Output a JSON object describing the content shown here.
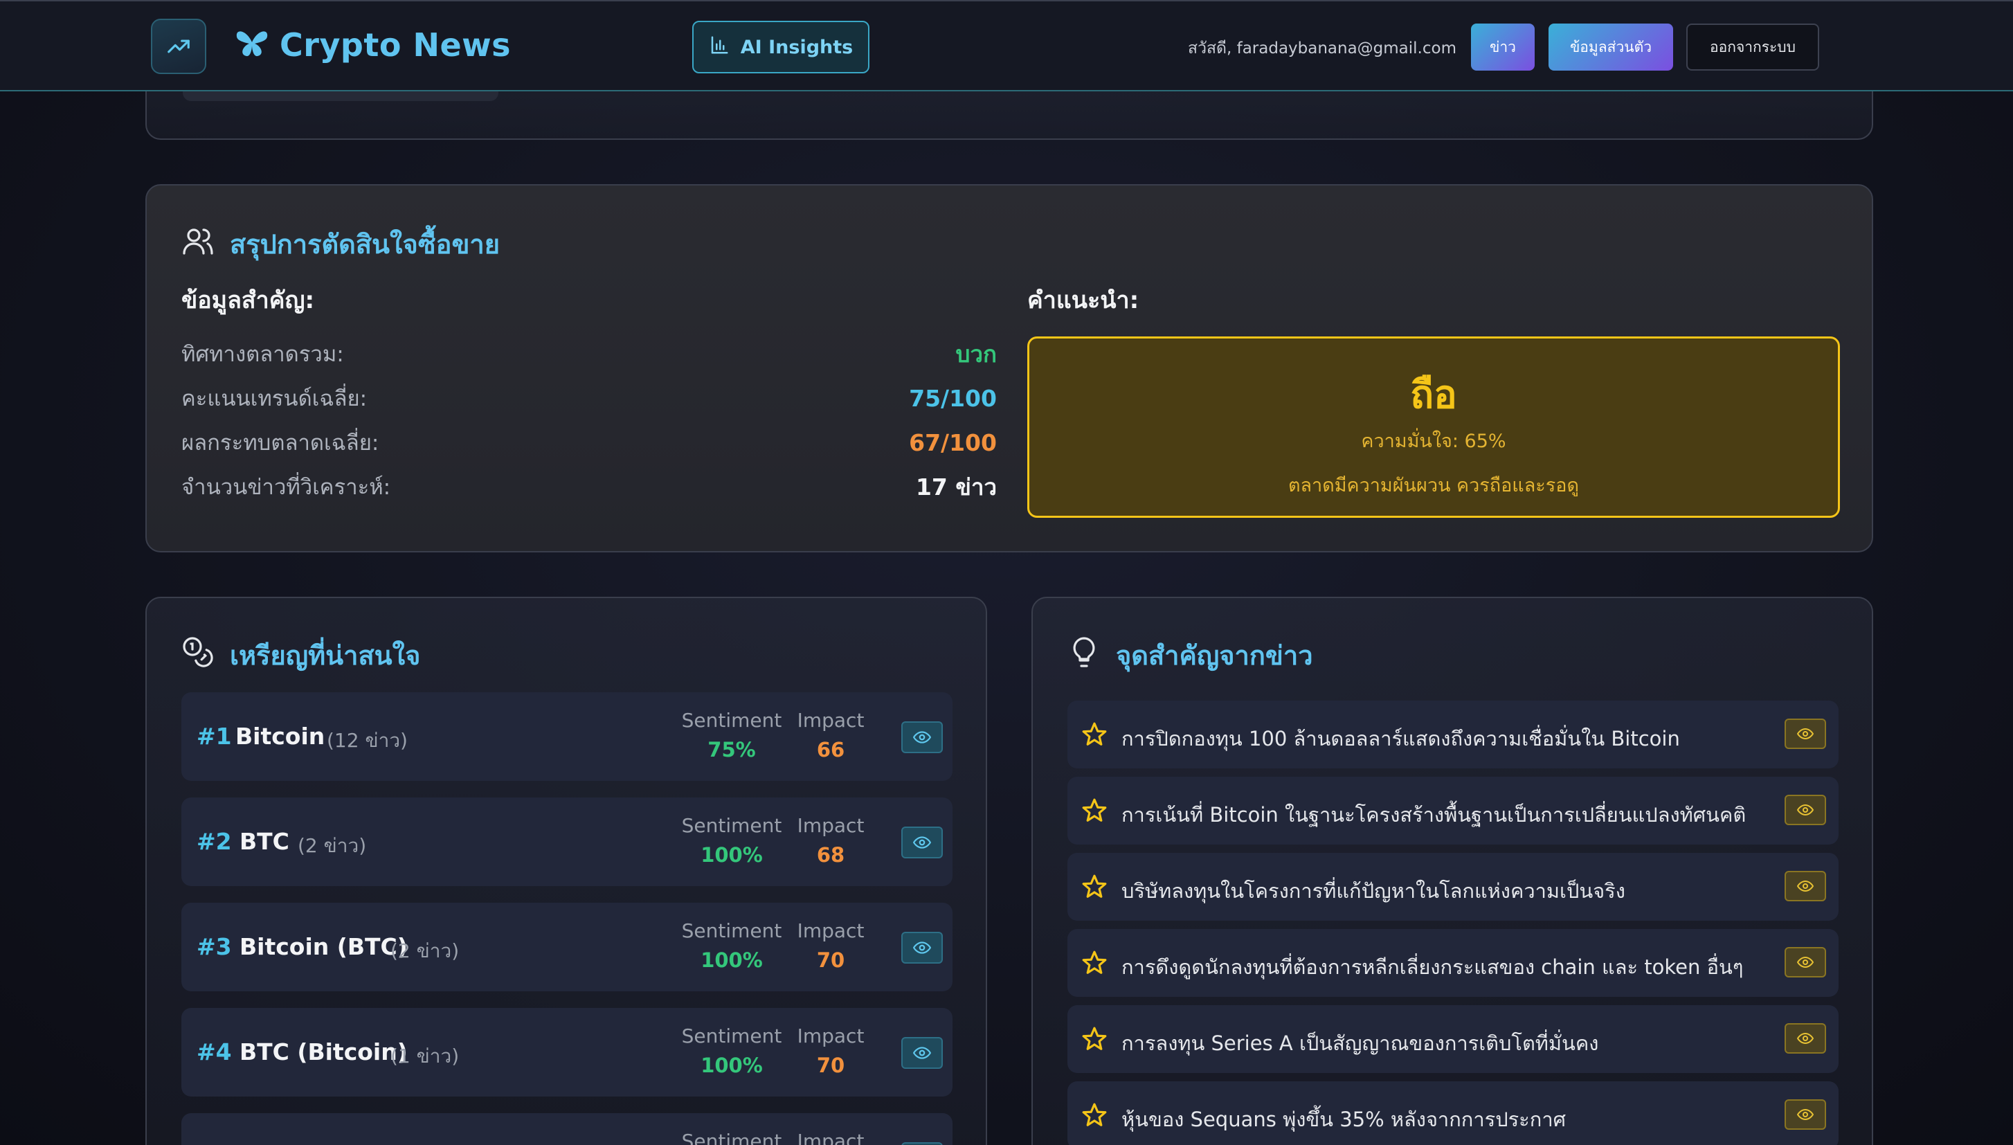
{
  "header": {
    "brand_title": "Crypto News",
    "ai_button_label": "AI Insights",
    "greeting": "สวัสดี, faradaybanana@gmail.com",
    "nav_news": "ข่าว",
    "nav_profile": "ข้อมูลส่วนตัว",
    "nav_logout": "ออกจากระบบ",
    "icons": [
      "trending-up-icon",
      "butterfly-logo-icon",
      "bar-chart-icon"
    ]
  },
  "summary": {
    "title": "สรุปการตัดสินใจซื้อขาย",
    "key_info_heading": "ข้อมูลสำคัญ:",
    "rows": [
      {
        "label": "ทิศทางตลาดรวม:",
        "value": "บวก",
        "color": "#34c77b"
      },
      {
        "label": "คะแนนเทรนด์เฉลี่ย:",
        "value": "75/100",
        "color": "#4cc3e8"
      },
      {
        "label": "ผลกระทบตลาดเฉลี่ย:",
        "value": "67/100",
        "color": "#f2913d"
      },
      {
        "label": "จำนวนข่าวที่วิเคราะห์:",
        "value": "17 ข่าว",
        "color": "#f3f4f6"
      }
    ],
    "recommendation_heading": "คำแนะนำ:",
    "recommendation": {
      "action": "ถือ",
      "confidence": "ความมั่นใจ: 65%",
      "note": "ตลาดมีความผันผวน ควรถือและรอดู",
      "color": "#f5c518"
    }
  },
  "coins": {
    "title": "เหรียญที่น่าสนใจ",
    "sentiment_label": "Sentiment",
    "impact_label": "Impact",
    "sentiment_color": "#34c77b",
    "impact_color": "#f2913d",
    "items": [
      {
        "rank": "#1",
        "name": "Bitcoin",
        "count": "(12 ข่าว)",
        "sentiment": "75%",
        "impact": "66"
      },
      {
        "rank": "#2",
        "name": "BTC",
        "count": "(2 ข่าว)",
        "sentiment": "100%",
        "impact": "68"
      },
      {
        "rank": "#3",
        "name": "Bitcoin (BTC)",
        "count": "(2 ข่าว)",
        "sentiment": "100%",
        "impact": "70"
      },
      {
        "rank": "#4",
        "name": "BTC (Bitcoin)",
        "count": "(1 ข่าว)",
        "sentiment": "100%",
        "impact": "70"
      },
      {
        "rank": "",
        "name": "",
        "count": "",
        "sentiment": "",
        "impact": ""
      }
    ]
  },
  "key_points": {
    "title": "จุดสำคัญจากข่าว",
    "items": [
      "การปิดกองทุน 100 ล้านดอลลาร์แสดงถึงความเชื่อมั่นใน Bitcoin",
      "การเน้นที่ Bitcoin ในฐานะโครงสร้างพื้นฐานเป็นการเปลี่ยนแปลงทัศนคติ",
      "บริษัทลงทุนในโครงการที่แก้ปัญหาในโลกแห่งความเป็นจริง",
      "การดึงดูดนักลงทุนที่ต้องการหลีกเลี่ยงกระแสของ chain และ token อื่นๆ",
      "การลงทุน Series A เป็นสัญญาณของการเติบโตที่มั่นคง",
      "หุ้นของ Sequans พุ่งขึ้น 35% หลังจากการประกาศ"
    ]
  }
}
